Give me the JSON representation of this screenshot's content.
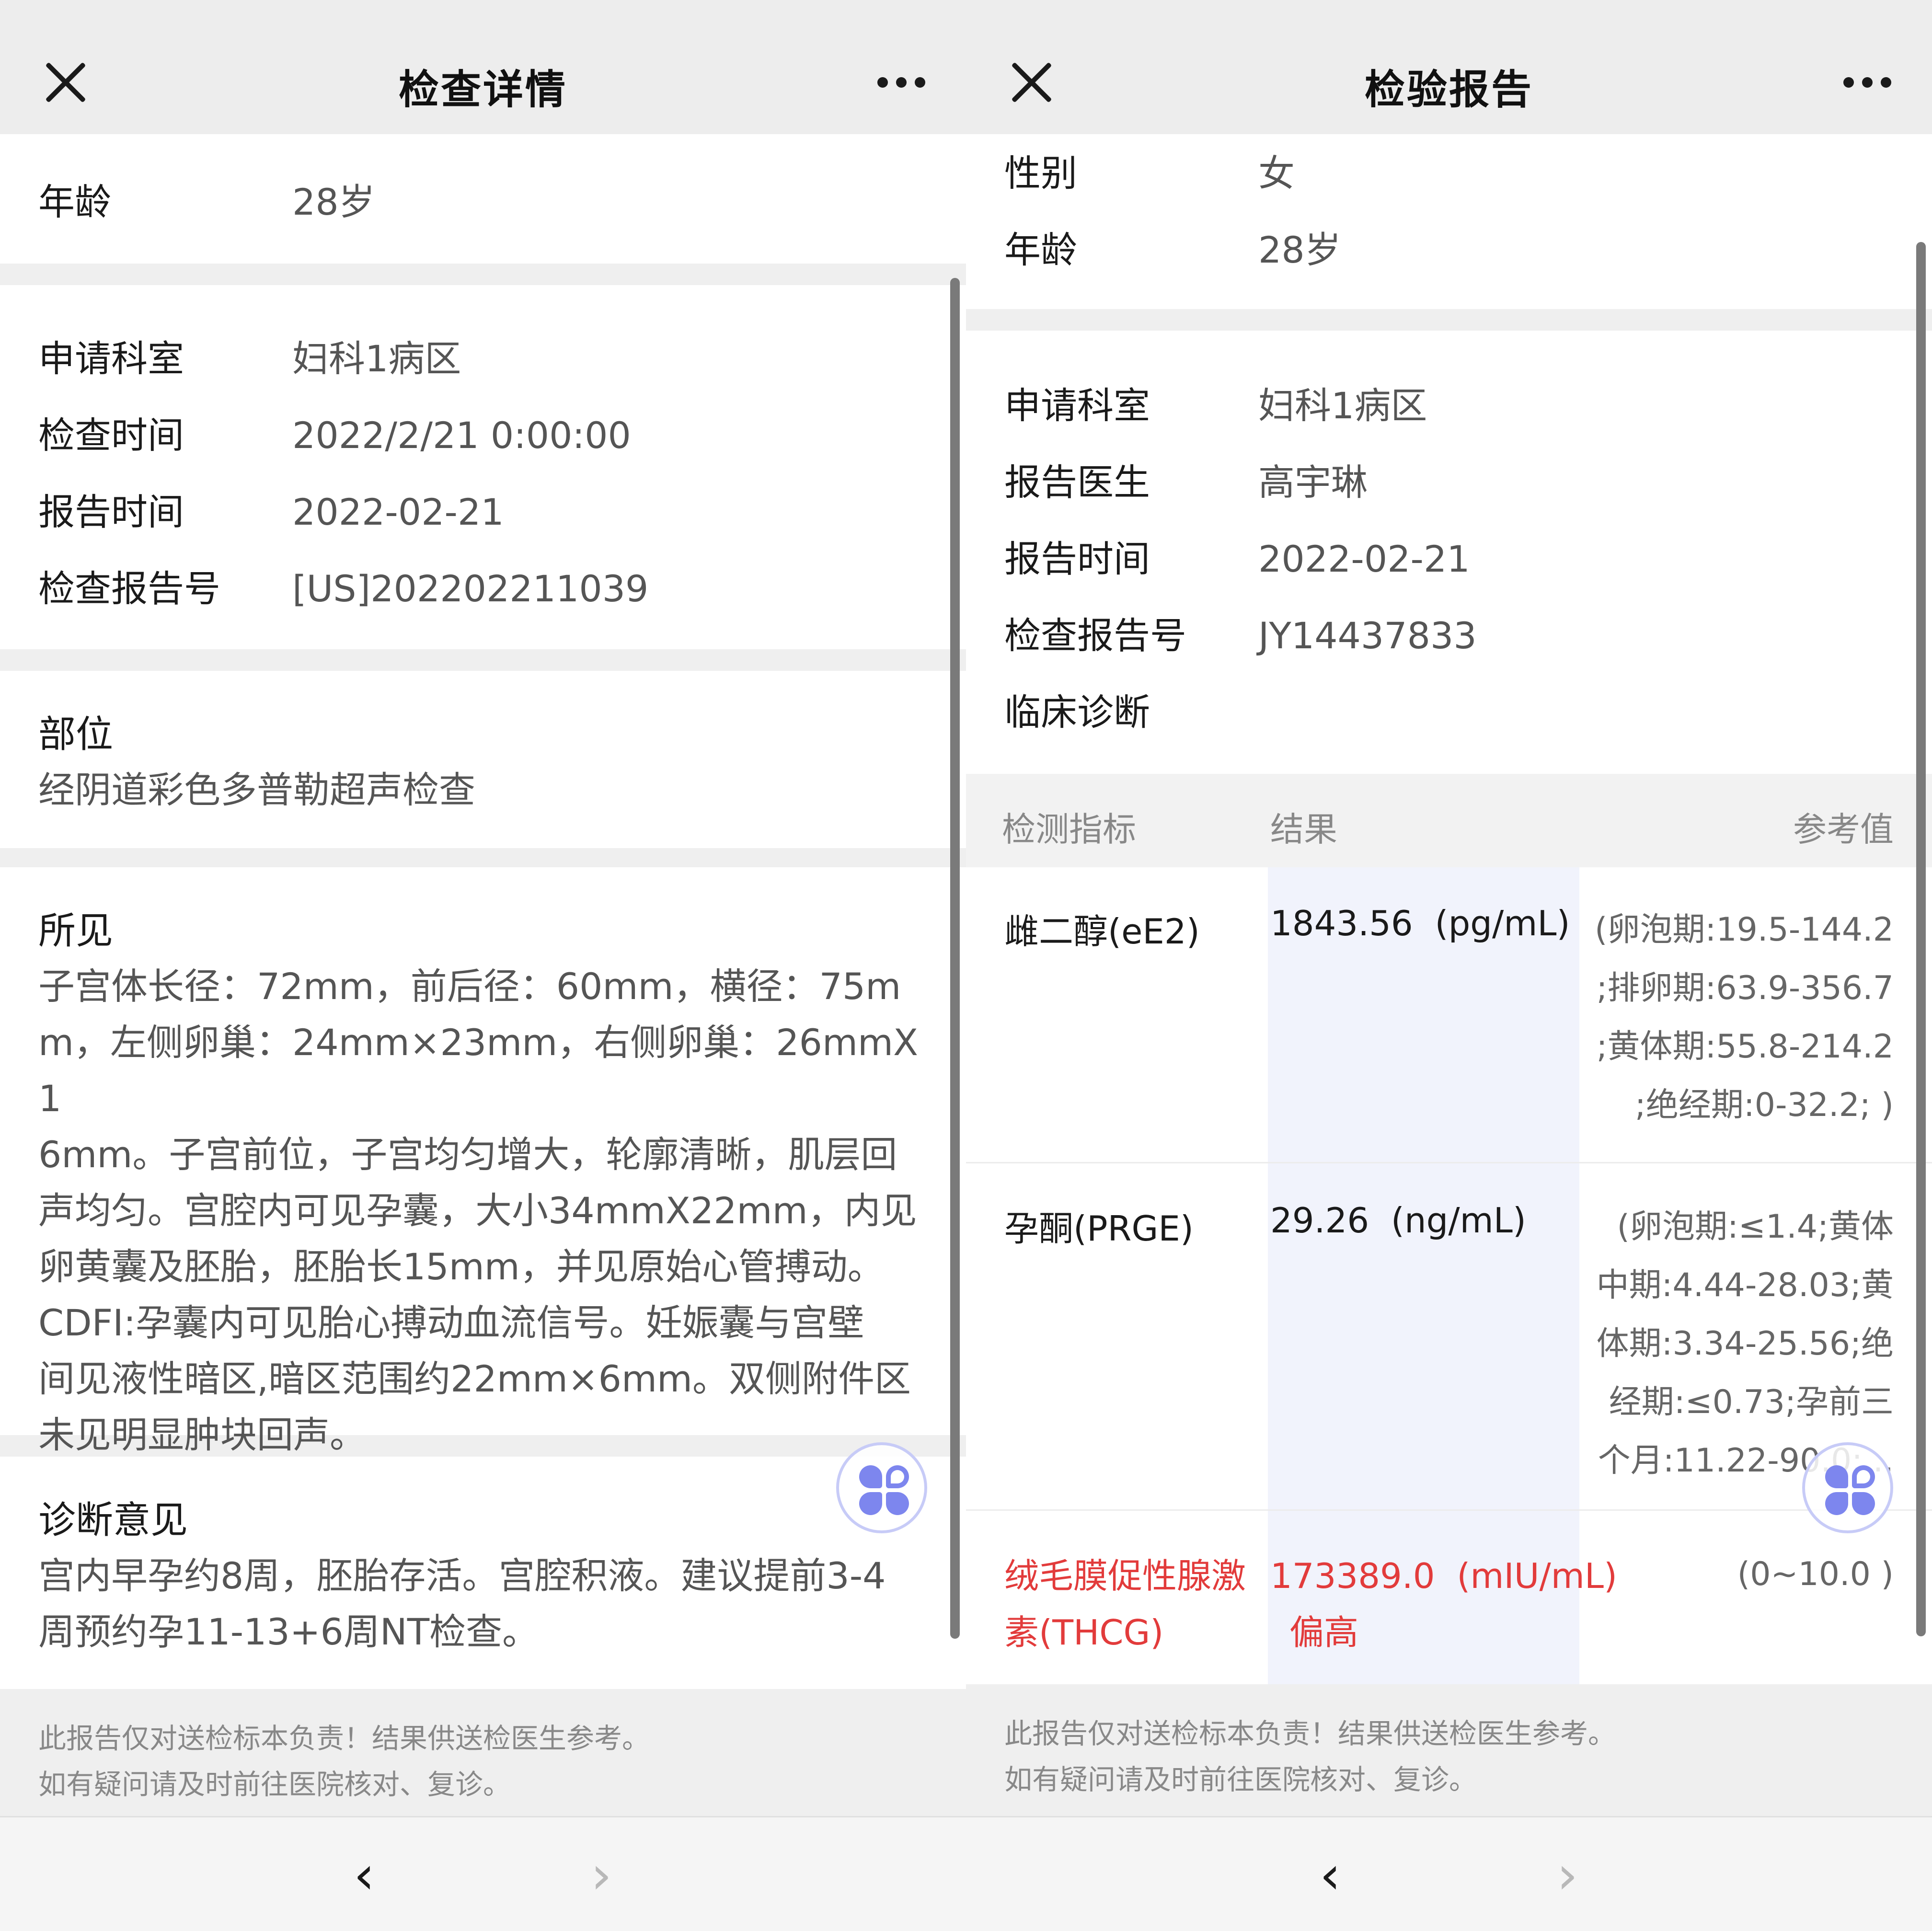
{
  "left": {
    "header": {
      "title": "检查详情"
    },
    "age": {
      "label": "年龄",
      "value": "28岁"
    },
    "info": [
      {
        "label": "申请科室",
        "value": "妇科1病区"
      },
      {
        "label": "检查时间",
        "value": "2022/2/21 0:00:00"
      },
      {
        "label": "报告时间",
        "value": "2022-02-21"
      },
      {
        "label": "检查报告号",
        "value": "[US]202202211039"
      }
    ],
    "site": {
      "title": "部位",
      "text": "经阴道彩色多普勒超声检查"
    },
    "findings": {
      "title": "所见",
      "lines": [
        "子宫体长径：72mm，前后径：60mm，横径：75m",
        "m，左侧卵巢：24mm×23mm，右侧卵巢：26mmX1",
        "6mm。子宫前位，子宫均匀增大，轮廓清晰，肌层回",
        "声均匀。宫腔内可见孕囊，大小34mmX22mm，内见",
        "卵黄囊及胚胎，胚胎长15mm，并见原始心管搏动。",
        "CDFI:孕囊内可见胎心搏动血流信号。妊娠囊与宫壁",
        "间见液性暗区,暗区范围约22mm×6mm。双侧附件区",
        "未见明显肿块回声。"
      ]
    },
    "diagnosis": {
      "title": "诊断意见",
      "lines": [
        "宫内早孕约8周，胚胎存活。宫腔积液。建议提前3-4",
        "周预约孕11-13+6周NT检查。"
      ]
    },
    "footer": {
      "line1": "此报告仅对送检标本负责！结果供送检医生参考。",
      "line2": "如有疑问请及时前往医院核对、复诊。"
    }
  },
  "right": {
    "header": {
      "title": "检验报告"
    },
    "basic": [
      {
        "label": "性别",
        "value": "女"
      },
      {
        "label": "年龄",
        "value": "28岁"
      }
    ],
    "info": [
      {
        "label": "申请科室",
        "value": "妇科1病区"
      },
      {
        "label": "报告医生",
        "value": "高宇琳"
      },
      {
        "label": "报告时间",
        "value": "2022-02-21"
      },
      {
        "label": "检查报告号",
        "value": "JY14437833"
      },
      {
        "label": "临床诊断",
        "value": ""
      }
    ],
    "table": {
      "headers": {
        "item": "检测指标",
        "result": "结果",
        "reference": "参考值"
      },
      "rows": [
        {
          "item": "雌二醇(eE2)",
          "result": "1843.56  (pg/mL)",
          "flag": "",
          "ref_lines": [
            "(卵泡期:19.5-144.2",
            ";排卵期:63.9-356.7",
            ";黄体期:55.8-214.2",
            ";绝经期:0-32.2; )"
          ]
        },
        {
          "item": "孕酮(PRGE)",
          "result": "29.26  (ng/mL)",
          "flag": "",
          "ref_lines": [
            "(卵泡期:≤1.4;黄体",
            "中期:4.44-28.03;黄",
            "体期:3.34-25.56;绝",
            "经期:≤0.73;孕前三",
            "个月:11.22-90.0;..."
          ]
        },
        {
          "item_line1": "绒毛膜促性腺激",
          "item_line2": "素(THCG)",
          "result": "173389.0  (mIU/mL)",
          "flag": "偏高",
          "ref_lines": [
            "(0~10.0 )"
          ]
        }
      ]
    },
    "footer": {
      "line1": "此报告仅对送检标本负责！结果供送检医生参考。",
      "line2": "如有疑问请及时前往医院核对、复诊。"
    }
  },
  "colors": {
    "high": "#e23b3b",
    "accent": "#7d86ee",
    "result_bg": "#f1f3fc"
  },
  "icons": [
    "close-icon",
    "more-icon",
    "floating-assistant-icon",
    "back-arrow-icon",
    "forward-arrow-icon"
  ]
}
